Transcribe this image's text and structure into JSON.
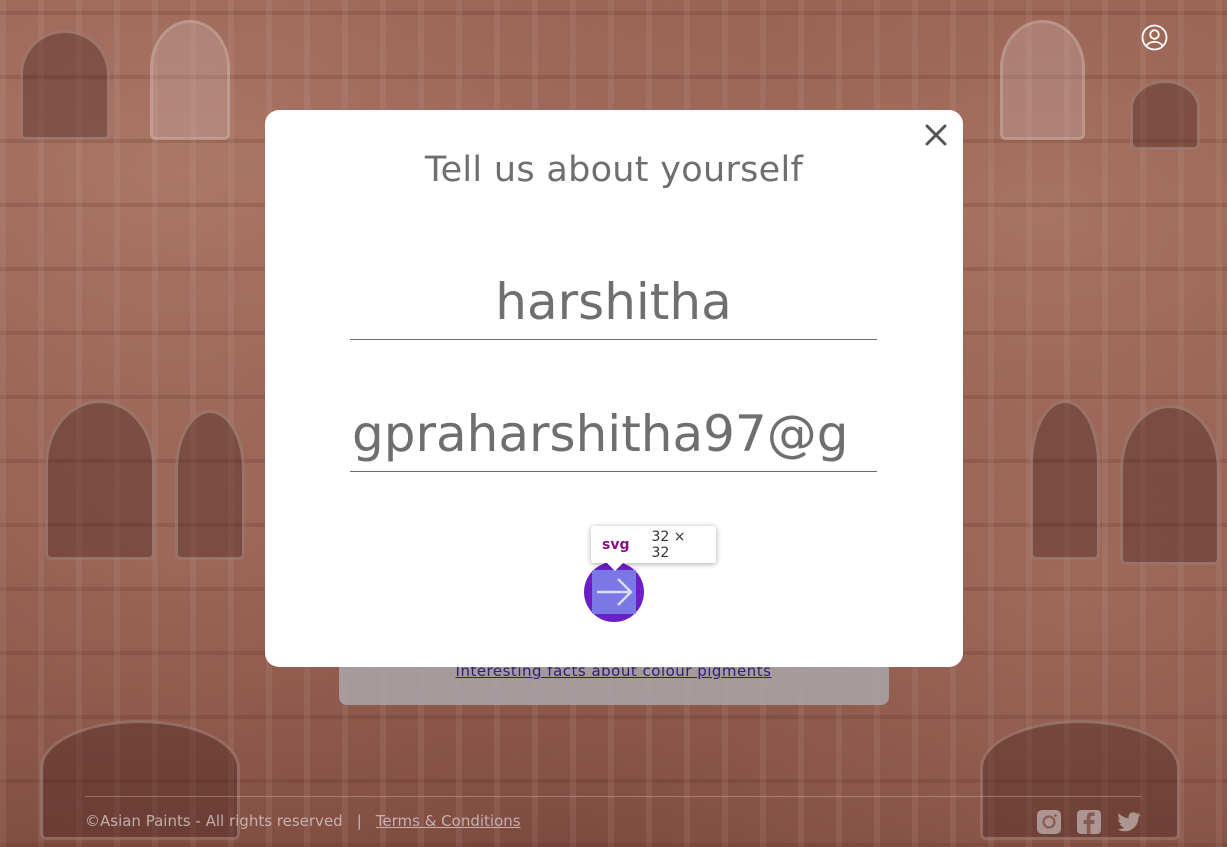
{
  "page": {
    "profile_icon": "user-circle-icon"
  },
  "background_card": {
    "link_text": "Interesting facts about colour pigments"
  },
  "modal": {
    "title": "Tell us about yourself",
    "close_icon": "close-icon",
    "name_value": "harshitha",
    "email_value": "gpraharshitha97@g",
    "submit_icon": "arrow-right-icon",
    "submit_color": "#6a1fc7"
  },
  "devtools_tooltip": {
    "tag": "svg",
    "dimensions": "32 × 32"
  },
  "footer": {
    "copyright": "©Asian Paints - All rights reserved",
    "separator": "|",
    "terms_label": "Terms & Conditions",
    "social_icons": [
      "instagram-icon",
      "facebook-icon",
      "twitter-icon"
    ]
  }
}
